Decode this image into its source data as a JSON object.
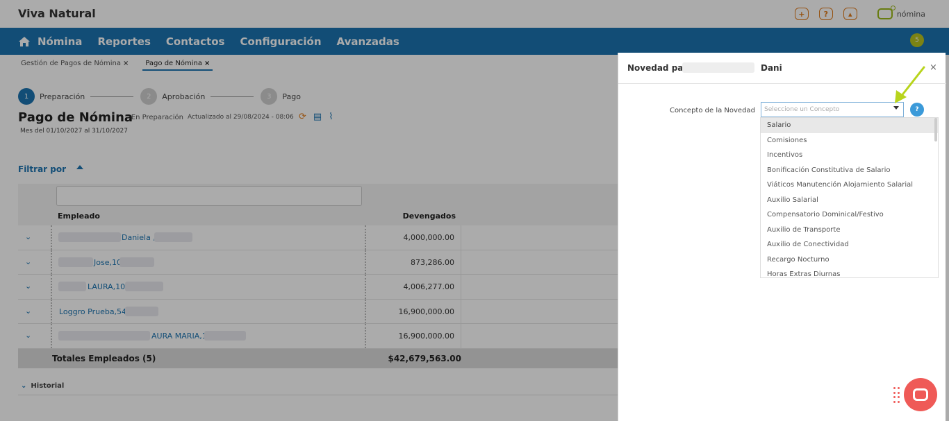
{
  "app": {
    "title": "Viva Natural",
    "top_icons": [
      "plus-icon",
      "help-icon",
      "notification-icon"
    ],
    "brand": "nómina"
  },
  "nav": {
    "items": [
      "Nómina",
      "Reportes",
      "Contactos",
      "Configuración",
      "Avanzadas"
    ],
    "badge": "5"
  },
  "breadcrumbs": [
    "Gestión de Pagos de Nómina",
    "Pago de Nómina"
  ],
  "steps": [
    {
      "num": "1",
      "label": "Preparación"
    },
    {
      "num": "2",
      "label": "Aprobación"
    },
    {
      "num": "3",
      "label": "Pago"
    }
  ],
  "page": {
    "title": "Pago de Nómina",
    "status": "- En Preparación",
    "updated": "Actualizado al 29/08/2024 - 08:06",
    "period": "Mes del 01/10/2027 al 31/10/2027",
    "filter": "Filtrar por",
    "historial": "Historial"
  },
  "table": {
    "headers": {
      "employee": "Empleado",
      "accrued": "Devengados"
    },
    "rows": [
      {
        "name": "Daniela ,43",
        "amount": "4,000,000.00"
      },
      {
        "name": "Jose,10",
        "amount": "873,286.00"
      },
      {
        "name": "LAURA,10",
        "amount": "4,006,277.00"
      },
      {
        "name": "Loggro Prueba,54",
        "amount": "16,900,000.00"
      },
      {
        "name": "AURA MARIA,1C",
        "amount": "16,900,000.00"
      }
    ],
    "footer": {
      "label": "Totales Empleados (5)",
      "total": "$42,679,563.00"
    }
  },
  "panel": {
    "title_prefix": "Novedad para",
    "title_name": "Dani",
    "close": "×",
    "field_label": "Concepto de la Novedad",
    "select_placeholder": "Seleccione un Concepto",
    "help": "?",
    "options": [
      "Salario",
      "Comisiones",
      "Incentivos",
      "Bonificación Constitutiva de Salario",
      "Viáticos Manutención Alojamiento Salarial",
      "Auxilio Salarial",
      "Compensatorio Dominical/Festivo",
      "Auxilio de Transporte",
      "Auxilio de Conectividad",
      "Recargo Nocturno",
      "Horas Extras Diurnas"
    ],
    "selected_option": "Salario"
  },
  "colors": {
    "primary": "#1b74b1",
    "accent": "#e07b1a",
    "chat": "#ef5a57",
    "arrow": "#b8d41c"
  }
}
